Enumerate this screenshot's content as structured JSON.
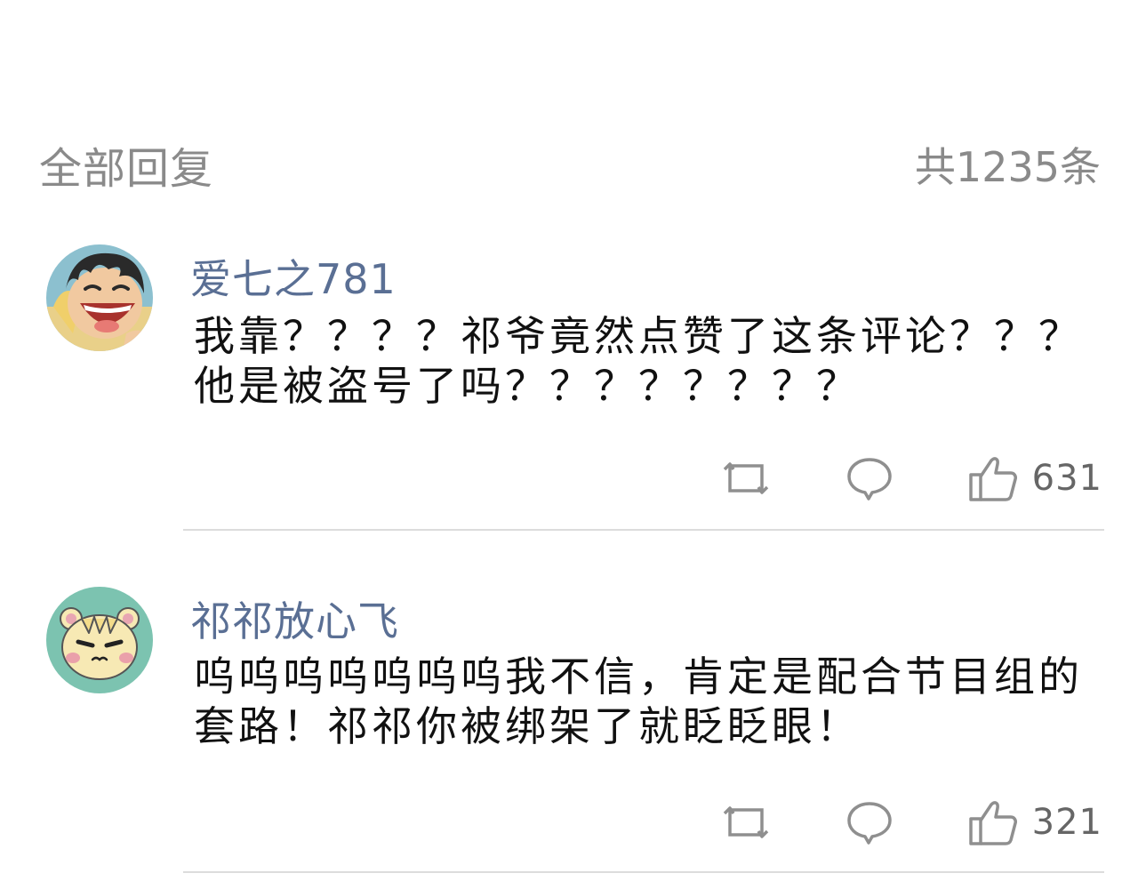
{
  "header": {
    "title": "全部回复",
    "count": "共1235条"
  },
  "comments": [
    {
      "username": "爱七之781",
      "avatar_icon": "cartoon-boy-laughing-avatar",
      "avatar_colors": {
        "bg": "#7fb7c8",
        "skin": "#f1c9a0",
        "hair": "#2a2a2a"
      },
      "text": "我靠？？？？祁爷竟然点赞了这条评论？？？他是被盗号了吗？？？？？？？？",
      "actions": {
        "repost_icon": "repost-icon",
        "reply_icon": "comment-bubble-icon",
        "like_icon": "thumbs-up-icon",
        "likes": "631"
      }
    },
    {
      "username": "祁祁放心飞",
      "avatar_icon": "cartoon-hamster-avatar",
      "avatar_colors": {
        "bg": "#7cc3b0",
        "face": "#f7e9b4",
        "ear": "#e8a6b2"
      },
      "text": "呜呜呜呜呜呜呜我不信，肯定是配合节目组的套路！祁祁你被绑架了就眨眨眼！",
      "actions": {
        "repost_icon": "repost-icon",
        "reply_icon": "comment-bubble-icon",
        "like_icon": "thumbs-up-icon",
        "likes": "321"
      }
    }
  ],
  "colors": {
    "username": "#5a6f94",
    "muted": "#8a8a8a",
    "icon": "#8f8f8f",
    "divider": "#dcdcdc"
  }
}
